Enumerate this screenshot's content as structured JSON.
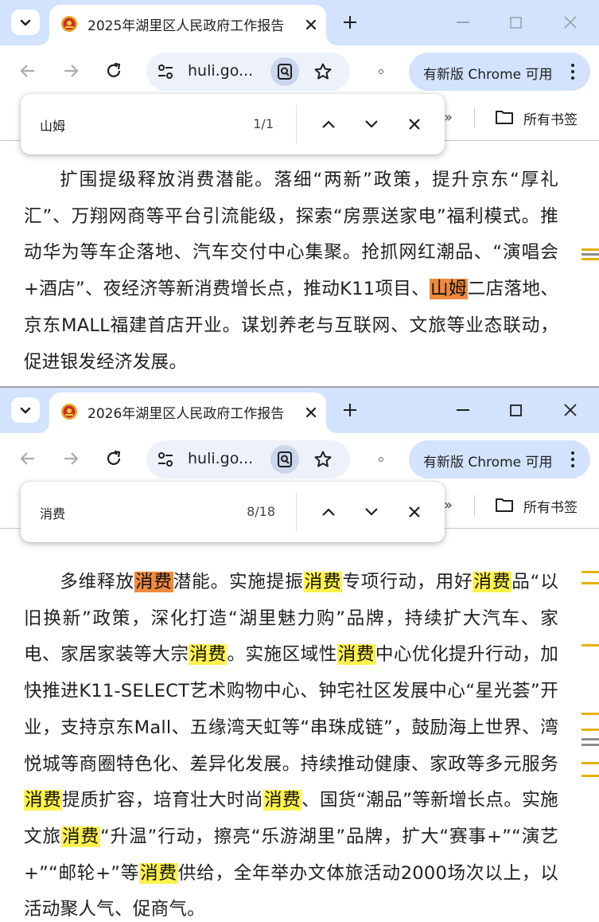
{
  "windows": [
    {
      "tab_title": "2025年湖里区人民政府工作报告",
      "url": "huli.go...",
      "update_label": "有新版 Chrome 可用",
      "bookmarks_chevron": "»",
      "bookmarks_label": "所有书签",
      "find_query": "山姆",
      "find_count": "1/1",
      "paragraph": [
        {
          "t": "扩围提级释放消费潜能。落细“两新”政策，提升京东“厚礼汇”、万翔网商等平台引流能级，探索“房票送家电”福利模式。推动华为等车企落地、汽车交付中心集聚。抢抓网红潮品、“演唱会+酒店”、夜经济等新消费增长点，推动K11项目、"
        },
        {
          "t": "山姆",
          "h": "active"
        },
        {
          "t": "二店落地、京东MALL福建首店开业。谋划养老与互联网、文旅等业态联动，促进银发经济发展。"
        }
      ]
    },
    {
      "tab_title": "2026年湖里区人民政府工作报告",
      "url": "huli.go...",
      "update_label": "有新版 Chrome 可用",
      "bookmarks_chevron": "»",
      "bookmarks_label": "所有书签",
      "find_query": "消费",
      "find_count": "8/18",
      "paragraph": [
        {
          "t": "多维释放"
        },
        {
          "t": "消费",
          "h": "active"
        },
        {
          "t": "潜能。实施提振"
        },
        {
          "t": "消费",
          "h": "match"
        },
        {
          "t": "专项行动，用好"
        },
        {
          "t": "消费",
          "h": "match"
        },
        {
          "t": "品“以旧换新”政策，深化打造“湖里魅力购”品牌，持续扩大汽车、家电、家居家装等大宗"
        },
        {
          "t": "消费",
          "h": "match"
        },
        {
          "t": "。实施区域性"
        },
        {
          "t": "消费",
          "h": "match"
        },
        {
          "t": "中心优化提升行动，加快推进K11-SELECT艺术购物中心、钟宅社区发展中心“星光荟”开业，支持京东Mall、五缘湾天虹等“串珠成链”，鼓励海上世界、湾悦城等商圈特色化、差异化发展。持续推动健康、家政等多元服务"
        },
        {
          "t": "消费",
          "h": "match"
        },
        {
          "t": "提质扩容，培育壮大时尚"
        },
        {
          "t": "消费",
          "h": "match"
        },
        {
          "t": "、国货“潮品”等新增长点。实施文旅"
        },
        {
          "t": "消费",
          "h": "match"
        },
        {
          "t": "“升温”行动，擦亮“乐游湖里”品牌，扩大“赛事+”“演艺+”“邮轮+”等"
        },
        {
          "t": "消费",
          "h": "match"
        },
        {
          "t": "供给，全年举办文体旅活动2000场次以上，以活动聚人气、促商气。"
        }
      ]
    }
  ],
  "colors": {
    "tab_strip": "#d3e3fd",
    "omnibox": "#edf2fa",
    "match_highlight": "#fff24d",
    "active_match_highlight": "#f08a3e",
    "scrollbar_tick": "#e2b100"
  }
}
